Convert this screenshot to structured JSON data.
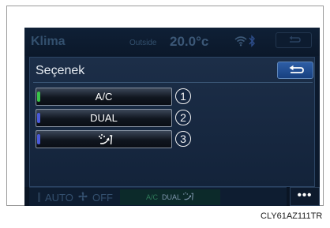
{
  "status": {
    "title": "Klima",
    "outside_label": "Outside",
    "temperature": "20.0°c",
    "icons": [
      "wifi-icon",
      "bluetooth-icon",
      "back-arrow-icon"
    ]
  },
  "panel": {
    "title": "Seçenek",
    "options": [
      {
        "label": "A/C",
        "indicator_color": "#39c24a",
        "callout": "1"
      },
      {
        "label": "DUAL",
        "indicator_color": "#4a5ad8",
        "callout": "2"
      },
      {
        "label": "",
        "icon": "recirculation-icon",
        "indicator_color": "#4a5ad8",
        "callout": "3"
      }
    ]
  },
  "bottom": {
    "auto": "AUTO",
    "off": "OFF",
    "ac": "A/C",
    "dual": "DUAL",
    "more": "•••"
  },
  "caption": "CLY61AZ111TR",
  "colors": {
    "screen_bg": "#0c1a2e",
    "accent_blue": "#2e5ea6",
    "ac_green": "#39c24a"
  }
}
